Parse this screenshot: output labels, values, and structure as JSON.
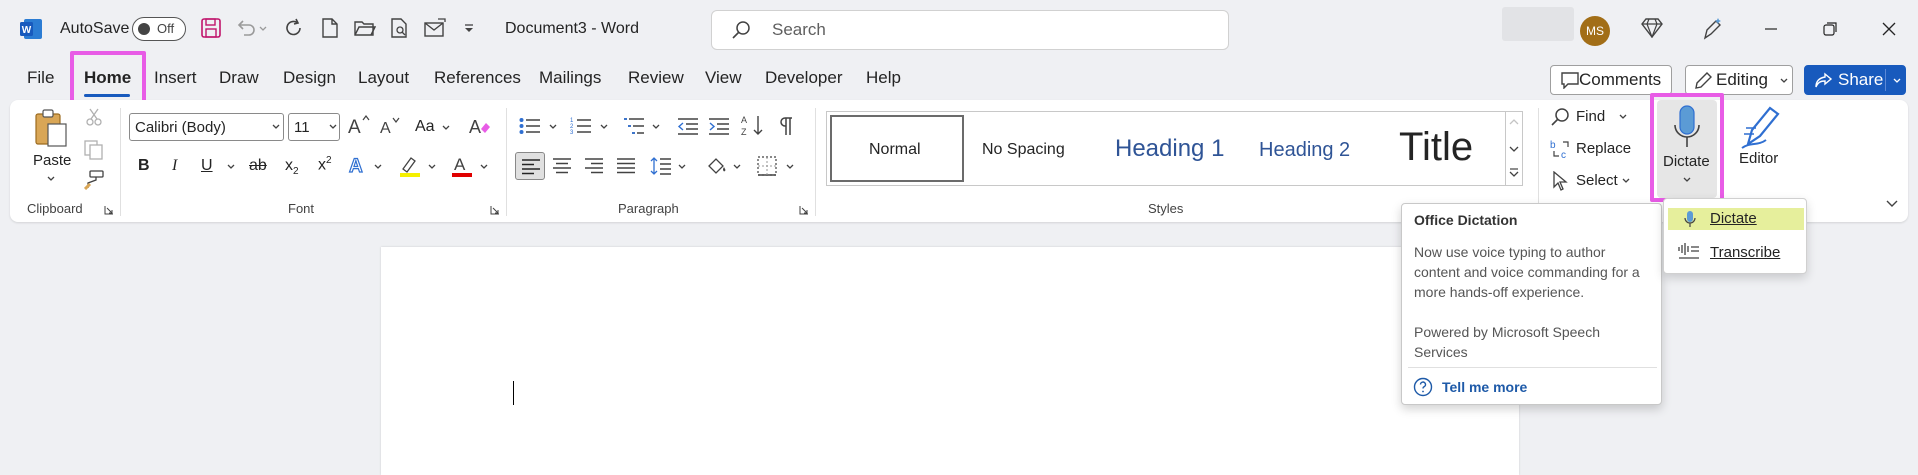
{
  "titlebar": {
    "autosave_label": "AutoSave",
    "autosave_state": "Off",
    "document_title": "Document3  -  Word",
    "search_placeholder": "Search",
    "user_initials": "MS"
  },
  "tabs": [
    "File",
    "Home",
    "Insert",
    "Draw",
    "Design",
    "Layout",
    "References",
    "Mailings",
    "Review",
    "View",
    "Developer",
    "Help"
  ],
  "active_tab": "Home",
  "top_buttons": {
    "comments": "Comments",
    "editing": "Editing",
    "share": "Share"
  },
  "ribbon": {
    "clipboard": {
      "label": "Clipboard",
      "paste": "Paste"
    },
    "font": {
      "label": "Font",
      "font_name": "Calibri (Body)",
      "font_size": "11",
      "case": "Aa"
    },
    "paragraph": {
      "label": "Paragraph"
    },
    "styles": {
      "label": "Styles",
      "items": [
        "Normal",
        "No Spacing",
        "Heading 1",
        "Heading 2",
        "Title"
      ]
    },
    "editing": {
      "find": "Find",
      "replace": "Replace",
      "select": "Select"
    },
    "voice": {
      "dictate": "Dictate"
    },
    "editor": {
      "label": "Editor"
    }
  },
  "tooltip": {
    "title": "Office Dictation",
    "body": "Now use voice typing to author content and voice commanding for a more hands-off experience.",
    "powered": "Powered by Microsoft Speech Services",
    "link": "Tell me more"
  },
  "dictate_menu": {
    "items": [
      "Dictate",
      "Transcribe"
    ],
    "selected": "Dictate"
  },
  "colors": {
    "accent": "#185abd",
    "highlight_box": "#e85ce6",
    "word_blue": "#185abd",
    "share_blue": "#185abd",
    "heading_blue": "#2f5496",
    "menu_selected": "#e6ef9c"
  }
}
